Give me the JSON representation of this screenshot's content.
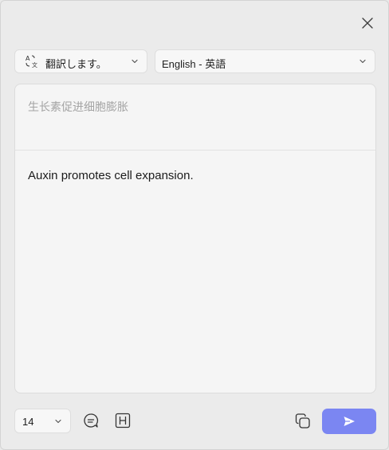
{
  "header": {
    "close_icon": "close-icon"
  },
  "mode_select": {
    "icon": "translate-icon",
    "label": "翻訳します。"
  },
  "language_select": {
    "label": "English - 英語"
  },
  "panel": {
    "source_text": "生长素促进细胞膨胀",
    "result_text": "Auxin promotes cell expansion."
  },
  "footer": {
    "font_size_value": "14",
    "icons": [
      "chat-icon",
      "heading-icon",
      "copy-icon",
      "send-icon"
    ]
  },
  "colors": {
    "accent": "#7b86f2",
    "background": "#ebebeb",
    "panel": "#f5f5f5"
  }
}
